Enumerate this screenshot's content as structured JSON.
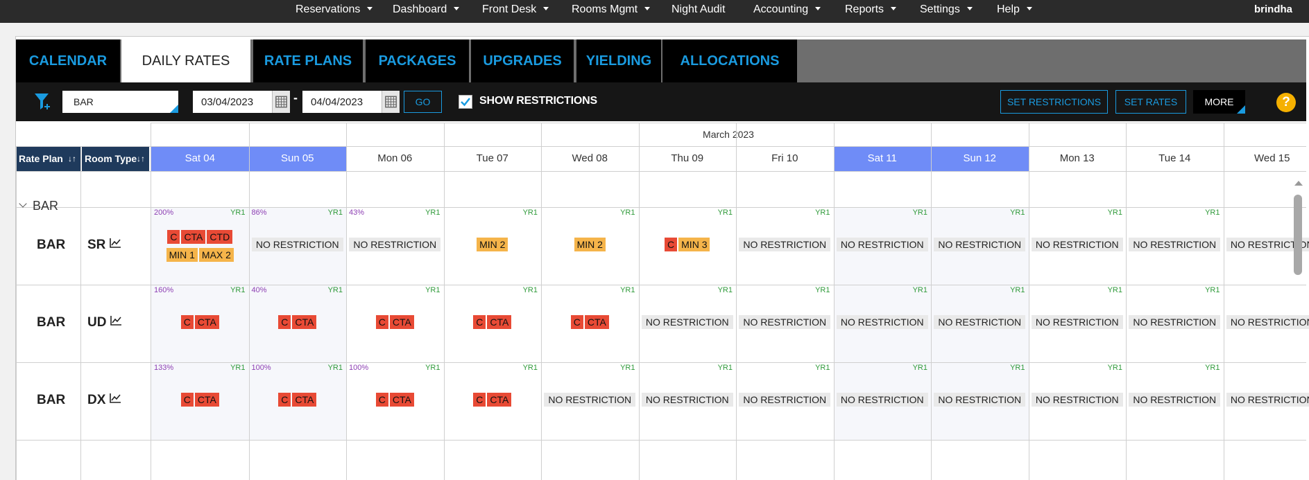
{
  "topnav": {
    "items": [
      {
        "label": "Reservations",
        "caret": true
      },
      {
        "label": "Dashboard",
        "caret": true
      },
      {
        "label": "Front Desk",
        "caret": true
      },
      {
        "label": "Rooms Mgmt",
        "caret": true
      },
      {
        "label": "Night Audit",
        "caret": false
      },
      {
        "label": "Accounting",
        "caret": true
      },
      {
        "label": "Reports",
        "caret": true
      },
      {
        "label": "Settings",
        "caret": true
      },
      {
        "label": "Help",
        "caret": true
      }
    ],
    "user": "brindha"
  },
  "tabs": [
    {
      "label": "CALENDAR",
      "active": false
    },
    {
      "label": "DAILY RATES",
      "active": true
    },
    {
      "label": "RATE PLANS",
      "active": false
    },
    {
      "label": "PACKAGES",
      "active": false
    },
    {
      "label": "UPGRADES",
      "active": false
    },
    {
      "label": "YIELDING",
      "active": false
    },
    {
      "label": "ALLOCATIONS",
      "active": false
    }
  ],
  "toolbar": {
    "rate_plan_value": "BAR",
    "date_from": "03/04/2023",
    "date_separator": "-",
    "date_to": "04/04/2023",
    "go_label": "GO",
    "show_restrictions_checked": true,
    "show_restrictions_label": "SHOW RESTRICTIONS",
    "set_restrictions_label": "SET RESTRICTIONS",
    "set_rates_label": "SET RATES",
    "more_label": "MORE",
    "help_label": "?"
  },
  "grid": {
    "month_label": "March 2023",
    "col_rate_plan": "Rate Plan",
    "col_room_type": "Room Type",
    "days": [
      {
        "label": "Sat 04",
        "weekend": true
      },
      {
        "label": "Sun 05",
        "weekend": true
      },
      {
        "label": "Mon 06",
        "weekend": false
      },
      {
        "label": "Tue 07",
        "weekend": false
      },
      {
        "label": "Wed 08",
        "weekend": false
      },
      {
        "label": "Thu 09",
        "weekend": false
      },
      {
        "label": "Fri 10",
        "weekend": false
      },
      {
        "label": "Sat 11",
        "weekend": true
      },
      {
        "label": "Sun 12",
        "weekend": true
      },
      {
        "label": "Mon 13",
        "weekend": false
      },
      {
        "label": "Tue 14",
        "weekend": false
      },
      {
        "label": "Wed 15",
        "weekend": false
      }
    ],
    "group_label": "BAR",
    "rows": [
      {
        "plan": "BAR",
        "room_type": "SR",
        "cells": [
          {
            "pct": "200%",
            "yr": "YR1",
            "lines": [
              [
                {
                  "t": "C",
                  "c": "red"
                },
                {
                  "t": "CTA",
                  "c": "red"
                },
                {
                  "t": "CTD",
                  "c": "red"
                }
              ],
              [
                {
                  "t": "MIN 1",
                  "c": "orange"
                },
                {
                  "t": "MAX 2",
                  "c": "orange"
                }
              ]
            ]
          },
          {
            "pct": "86%",
            "yr": "YR1",
            "lines": [
              [
                {
                  "t": "NO RESTRICTION",
                  "c": "grey"
                }
              ]
            ]
          },
          {
            "pct": "43%",
            "yr": "YR1",
            "lines": [
              [
                {
                  "t": "NO RESTRICTION",
                  "c": "grey"
                }
              ]
            ]
          },
          {
            "pct": "",
            "yr": "YR1",
            "lines": [
              [
                {
                  "t": "MIN 2",
                  "c": "orange"
                }
              ]
            ]
          },
          {
            "pct": "",
            "yr": "YR1",
            "lines": [
              [
                {
                  "t": "MIN 2",
                  "c": "orange"
                }
              ]
            ]
          },
          {
            "pct": "",
            "yr": "YR1",
            "lines": [
              [
                {
                  "t": "C",
                  "c": "red"
                },
                {
                  "t": "MIN 3",
                  "c": "orange"
                }
              ]
            ]
          },
          {
            "pct": "",
            "yr": "YR1",
            "lines": [
              [
                {
                  "t": "NO RESTRICTION",
                  "c": "grey"
                }
              ]
            ]
          },
          {
            "pct": "",
            "yr": "YR1",
            "lines": [
              [
                {
                  "t": "NO RESTRICTION",
                  "c": "grey"
                }
              ]
            ]
          },
          {
            "pct": "",
            "yr": "YR1",
            "lines": [
              [
                {
                  "t": "NO RESTRICTION",
                  "c": "grey"
                }
              ]
            ]
          },
          {
            "pct": "",
            "yr": "YR1",
            "lines": [
              [
                {
                  "t": "NO RESTRICTION",
                  "c": "grey"
                }
              ]
            ]
          },
          {
            "pct": "",
            "yr": "YR1",
            "lines": [
              [
                {
                  "t": "NO RESTRICTION",
                  "c": "grey"
                }
              ]
            ]
          },
          {
            "pct": "",
            "yr": "",
            "lines": [
              [
                {
                  "t": "NO RESTRICTION",
                  "c": "grey"
                }
              ]
            ]
          }
        ]
      },
      {
        "plan": "BAR",
        "room_type": "UD",
        "cells": [
          {
            "pct": "160%",
            "yr": "YR1",
            "lines": [
              [
                {
                  "t": "C",
                  "c": "red"
                },
                {
                  "t": "CTA",
                  "c": "red"
                }
              ]
            ]
          },
          {
            "pct": "40%",
            "yr": "YR1",
            "lines": [
              [
                {
                  "t": "C",
                  "c": "red"
                },
                {
                  "t": "CTA",
                  "c": "red"
                }
              ]
            ]
          },
          {
            "pct": "",
            "yr": "YR1",
            "lines": [
              [
                {
                  "t": "C",
                  "c": "red"
                },
                {
                  "t": "CTA",
                  "c": "red"
                }
              ]
            ]
          },
          {
            "pct": "",
            "yr": "YR1",
            "lines": [
              [
                {
                  "t": "C",
                  "c": "red"
                },
                {
                  "t": "CTA",
                  "c": "red"
                }
              ]
            ]
          },
          {
            "pct": "",
            "yr": "YR1",
            "lines": [
              [
                {
                  "t": "C",
                  "c": "red"
                },
                {
                  "t": "CTA",
                  "c": "red"
                }
              ]
            ]
          },
          {
            "pct": "",
            "yr": "YR1",
            "lines": [
              [
                {
                  "t": "NO RESTRICTION",
                  "c": "grey"
                }
              ]
            ]
          },
          {
            "pct": "",
            "yr": "YR1",
            "lines": [
              [
                {
                  "t": "NO RESTRICTION",
                  "c": "grey"
                }
              ]
            ]
          },
          {
            "pct": "",
            "yr": "YR1",
            "lines": [
              [
                {
                  "t": "NO RESTRICTION",
                  "c": "grey"
                }
              ]
            ]
          },
          {
            "pct": "",
            "yr": "YR1",
            "lines": [
              [
                {
                  "t": "NO RESTRICTION",
                  "c": "grey"
                }
              ]
            ]
          },
          {
            "pct": "",
            "yr": "YR1",
            "lines": [
              [
                {
                  "t": "NO RESTRICTION",
                  "c": "grey"
                }
              ]
            ]
          },
          {
            "pct": "",
            "yr": "YR1",
            "lines": [
              [
                {
                  "t": "NO RESTRICTION",
                  "c": "grey"
                }
              ]
            ]
          },
          {
            "pct": "",
            "yr": "",
            "lines": [
              [
                {
                  "t": "NO RESTRICTION",
                  "c": "grey"
                }
              ]
            ]
          }
        ]
      },
      {
        "plan": "BAR",
        "room_type": "DX",
        "cells": [
          {
            "pct": "133%",
            "yr": "YR1",
            "lines": [
              [
                {
                  "t": "C",
                  "c": "red"
                },
                {
                  "t": "CTA",
                  "c": "red"
                }
              ]
            ]
          },
          {
            "pct": "100%",
            "yr": "YR1",
            "lines": [
              [
                {
                  "t": "C",
                  "c": "red"
                },
                {
                  "t": "CTA",
                  "c": "red"
                }
              ]
            ]
          },
          {
            "pct": "100%",
            "yr": "YR1",
            "lines": [
              [
                {
                  "t": "C",
                  "c": "red"
                },
                {
                  "t": "CTA",
                  "c": "red"
                }
              ]
            ]
          },
          {
            "pct": "",
            "yr": "YR1",
            "lines": [
              [
                {
                  "t": "C",
                  "c": "red"
                },
                {
                  "t": "CTA",
                  "c": "red"
                }
              ]
            ]
          },
          {
            "pct": "",
            "yr": "YR1",
            "lines": [
              [
                {
                  "t": "NO RESTRICTION",
                  "c": "grey"
                }
              ]
            ]
          },
          {
            "pct": "",
            "yr": "YR1",
            "lines": [
              [
                {
                  "t": "NO RESTRICTION",
                  "c": "grey"
                }
              ]
            ]
          },
          {
            "pct": "",
            "yr": "YR1",
            "lines": [
              [
                {
                  "t": "NO RESTRICTION",
                  "c": "grey"
                }
              ]
            ]
          },
          {
            "pct": "",
            "yr": "YR1",
            "lines": [
              [
                {
                  "t": "NO RESTRICTION",
                  "c": "grey"
                }
              ]
            ]
          },
          {
            "pct": "",
            "yr": "YR1",
            "lines": [
              [
                {
                  "t": "NO RESTRICTION",
                  "c": "grey"
                }
              ]
            ]
          },
          {
            "pct": "",
            "yr": "YR1",
            "lines": [
              [
                {
                  "t": "NO RESTRICTION",
                  "c": "grey"
                }
              ]
            ]
          },
          {
            "pct": "",
            "yr": "YR1",
            "lines": [
              [
                {
                  "t": "NO RESTRICTION",
                  "c": "grey"
                }
              ]
            ]
          },
          {
            "pct": "",
            "yr": "",
            "lines": [
              [
                {
                  "t": "NO RESTRICTION",
                  "c": "grey"
                }
              ]
            ]
          }
        ]
      }
    ]
  },
  "colors": {
    "topnav": "#2b2b2b",
    "tab_text": "#1a9be0",
    "weekend": "#6f8cf7",
    "header_blue": "#1f3a5c",
    "chip_red": "#e84a35",
    "chip_orange": "#f5b44a",
    "chip_grey": "#e9e9e9",
    "pct": "#8d3fb3",
    "yr": "#2f9a3a"
  }
}
